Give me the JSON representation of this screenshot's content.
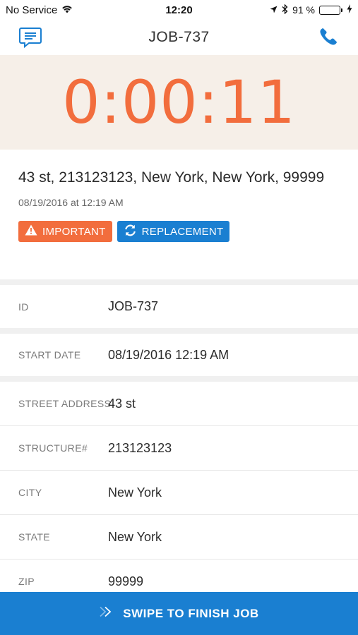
{
  "status_bar": {
    "carrier": "No Service",
    "time": "12:20",
    "battery_percent": "91 %",
    "battery_level": 0.91
  },
  "nav": {
    "title": "JOB-737",
    "left_icon": "chat-icon",
    "right_icon": "phone-icon"
  },
  "timer": {
    "value": "0:00:11"
  },
  "job": {
    "address": "43 st, 213123123, New York, New York, 99999",
    "datetime": "08/19/2016 at 12:19 AM",
    "tags": [
      {
        "label": "IMPORTANT",
        "icon": "warning-icon"
      },
      {
        "label": "REPLACEMENT",
        "icon": "refresh-icon"
      }
    ]
  },
  "details": {
    "id": {
      "label": "ID",
      "value": "JOB-737"
    },
    "start_date": {
      "label": "START DATE",
      "value": "08/19/2016 12:19 AM"
    },
    "street_address": {
      "label": "STREET ADDRESS",
      "value": "43 st"
    },
    "structure": {
      "label": "STRUCTURE#",
      "value": "213123123"
    },
    "city": {
      "label": "CITY",
      "value": "New York"
    },
    "state": {
      "label": "STATE",
      "value": "New York"
    },
    "zip": {
      "label": "ZIP",
      "value": "99999"
    }
  },
  "swipe": {
    "label": "SWIPE TO FINISH JOB",
    "icon": "double-chevron-right-icon"
  },
  "colors": {
    "accent_orange": "#f26d3d",
    "accent_blue": "#1a7fd1",
    "timer_bg": "#f6efe8"
  }
}
